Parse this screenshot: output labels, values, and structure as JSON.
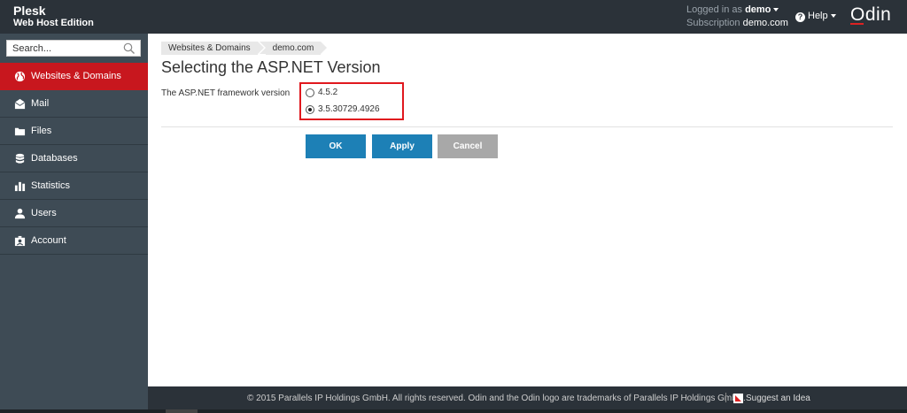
{
  "header": {
    "brand_name": "Plesk",
    "brand_edition": "Web Host Edition",
    "logged_in_label": "Logged in as",
    "logged_in_user": "demo",
    "subscription_label": "Subscription",
    "subscription_value": "demo.com",
    "help_label": "Help",
    "logo_text": "Odin"
  },
  "sidebar": {
    "search_placeholder": "Search...",
    "items": [
      {
        "label": "Websites & Domains",
        "icon": "globe-icon",
        "active": true
      },
      {
        "label": "Mail",
        "icon": "mail-icon"
      },
      {
        "label": "Files",
        "icon": "folder-icon"
      },
      {
        "label": "Databases",
        "icon": "database-icon"
      },
      {
        "label": "Statistics",
        "icon": "bar-chart-icon"
      },
      {
        "label": "Users",
        "icon": "user-icon"
      },
      {
        "label": "Account",
        "icon": "account-icon"
      }
    ]
  },
  "main": {
    "breadcrumb": [
      "Websites & Domains",
      "demo.com"
    ],
    "title": "Selecting the ASP.NET Version",
    "form_label": "The ASP.NET framework version",
    "options": [
      {
        "label": "4.5.2",
        "checked": false
      },
      {
        "label": "3.5.30729.4926",
        "checked": true
      }
    ],
    "buttons": {
      "ok": "OK",
      "apply": "Apply",
      "cancel": "Cancel"
    }
  },
  "footer": {
    "copyright": "© 2015 Parallels IP Holdings GmbH. All rights reserved. Odin and the Odin logo are trademarks of Parallels IP Holdings GmbH.",
    "suggest": "Suggest an Idea"
  },
  "colors": {
    "header_bg": "#2b3239",
    "sidebar_bg": "#3e4b55",
    "active_nav": "#c8171e",
    "primary_button": "#1d80b6",
    "cancel_button": "#a8a8a8",
    "highlight_border": "#e0181e"
  }
}
